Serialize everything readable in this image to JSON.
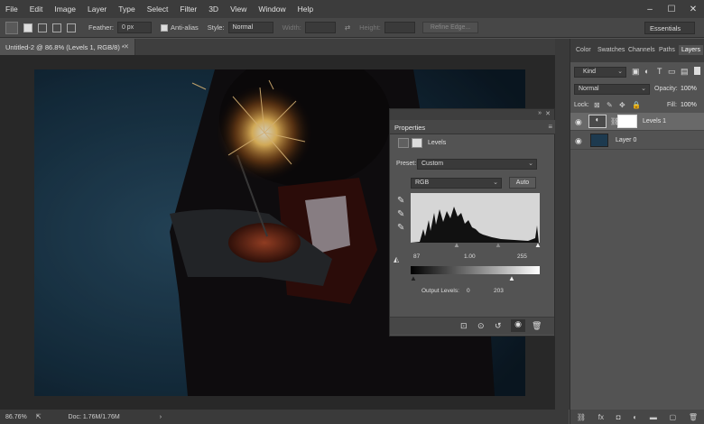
{
  "menu": [
    "File",
    "Edit",
    "Image",
    "Layer",
    "Type",
    "Select",
    "Filter",
    "3D",
    "View",
    "Window",
    "Help"
  ],
  "window_controls": [
    "–",
    "☐",
    "✕"
  ],
  "options": {
    "feather_label": "Feather:",
    "feather_value": "0 px",
    "antialias_label": "Anti-alias",
    "style_label": "Style:",
    "style_value": "Normal",
    "width_label": "Width:",
    "height_label": "Height:",
    "refine_edge": "Refine Edge...",
    "workspace": "Essentials"
  },
  "document": {
    "tab_title": "Untitled-2 @ 86.8% (Levels 1, RGB/8) *",
    "zoom": "86.76%",
    "doc_size": "Doc: 1.76M/1.76M"
  },
  "properties": {
    "title": "Properties",
    "adjustment_name": "Levels",
    "preset_label": "Preset:",
    "preset_value": "Custom",
    "channel": "RGB",
    "auto_label": "Auto",
    "input_black": "87",
    "input_gamma": "1.00",
    "input_white": "255",
    "output_label": "Output Levels:",
    "output_black": "0",
    "output_white": "203"
  },
  "right_panel": {
    "tabs": [
      "Color",
      "Swatches",
      "Channels",
      "Paths",
      "Layers"
    ],
    "active_tab": "Layers",
    "filter_kind": "Kind",
    "blend_mode": "Normal",
    "opacity_label": "Opacity:",
    "opacity_value": "100%",
    "lock_label": "Lock:",
    "fill_label": "Fill:",
    "fill_value": "100%",
    "layers": [
      {
        "name": "Levels 1",
        "selected": true
      },
      {
        "name": "Layer 0",
        "selected": false
      }
    ]
  },
  "colors": {
    "accent_selected": "#696969",
    "canvas_bg": "#282828"
  }
}
